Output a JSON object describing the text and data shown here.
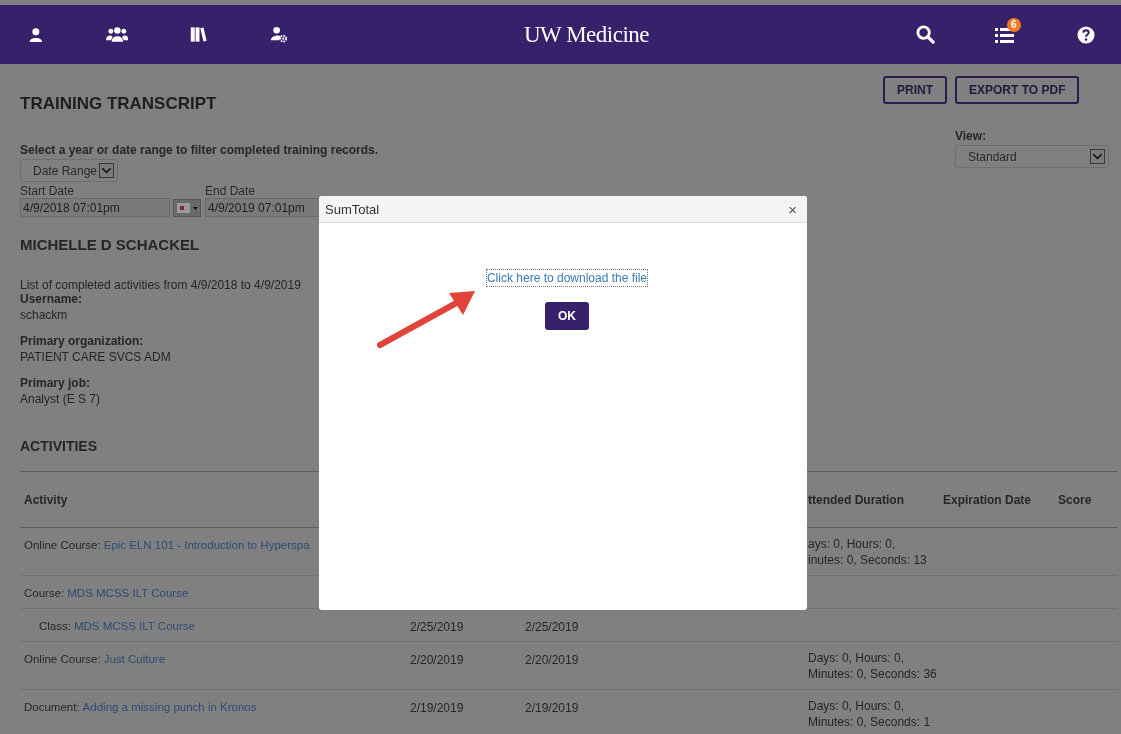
{
  "nav": {
    "brand": "UW Medicine",
    "badge": "6"
  },
  "page": {
    "title": "TRAINING TRANSCRIPT",
    "buttons": [
      "PRINT",
      "EXPORT TO PDF"
    ]
  },
  "filter": {
    "prompt": "Select a year or date range to filter completed training records.",
    "mode": "Date Range",
    "start_label": "Start Date",
    "start_value": "4/9/2018 07:01pm",
    "end_label": "End Date",
    "end_value": "4/9/2019 07:01pm"
  },
  "view": {
    "label": "View:",
    "value": "Standard"
  },
  "person": {
    "name": "MICHELLE D SCHACKEL",
    "summary": "List of completed activities from  4/9/2018  to  4/9/2019",
    "fields": [
      {
        "label": "Username:",
        "value": "schackm"
      },
      {
        "label": "Primary organization:",
        "value": "PATIENT CARE SVCS ADM"
      },
      {
        "label": "Primary job:",
        "value": "Analyst (E S 7)"
      }
    ]
  },
  "activities": {
    "title": "ACTIVITIES",
    "columns": [
      "Activity",
      "ttended Duration",
      "Expiration Date",
      "Score"
    ],
    "rows": [
      {
        "type": "Online Course:",
        "title": "Epic ELN 101 - Introduction to Hyperspa",
        "duration": "ays: 0, Hours: 0,\ninutes: 0, Seconds: 13"
      },
      {
        "type": "Course:",
        "title": "MDS MCSS ILT Course",
        "children": [
          {
            "type": "Class:",
            "title": "MDS MCSS ILT Course",
            "date_1": "2/25/2019",
            "date_2": "2/25/2019"
          }
        ]
      },
      {
        "type": "Online Course:",
        "title": "Just Culture",
        "date_1": "2/20/2019",
        "date_2": "2/20/2019",
        "duration": "Days: 0, Hours: 0,\nMinutes: 0, Seconds: 36"
      },
      {
        "type": "Document:",
        "title": "Adding a missing punch in Kronos",
        "date_1": "2/19/2019",
        "date_2": "2/19/2019",
        "duration": "Days: 0, Hours: 0,\nMinutes: 0, Seconds: 1"
      }
    ]
  },
  "dialog": {
    "title": "SumTotal",
    "close": "×",
    "link": "Click here to download the file",
    "button": "OK"
  }
}
